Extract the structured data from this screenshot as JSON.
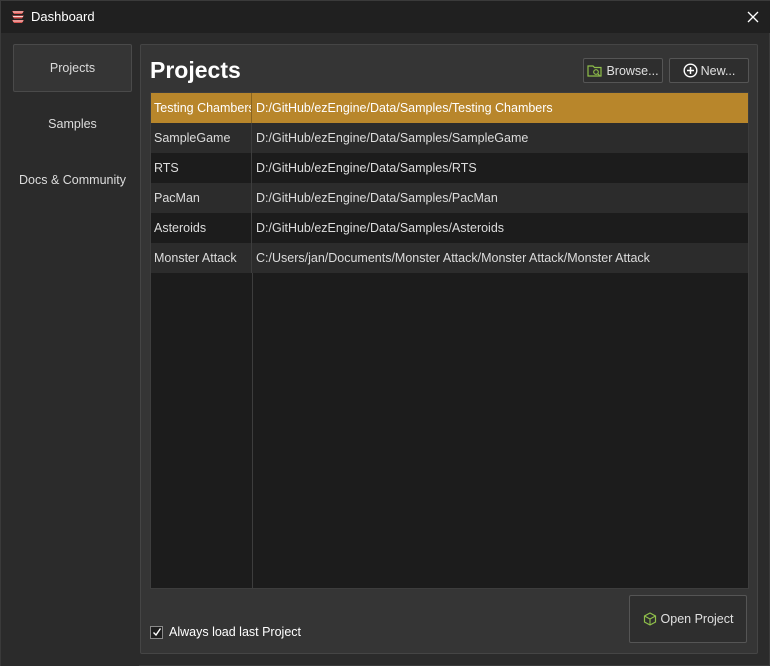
{
  "window": {
    "title": "Dashboard",
    "app_icon": "ez-engine-logo-icon",
    "close_icon": "close-icon"
  },
  "sidebar": {
    "items": [
      {
        "label": "Projects",
        "active": true
      },
      {
        "label": "Samples",
        "active": false
      },
      {
        "label": "Docs & Community",
        "active": false
      }
    ]
  },
  "main": {
    "title": "Projects",
    "browse_label": "Browse...",
    "browse_icon": "folder-search-icon",
    "new_label": "New...",
    "new_icon": "plus-circle-icon",
    "projects": [
      {
        "name": "Testing Chambers",
        "path": "D:/GitHub/ezEngine/Data/Samples/Testing Chambers",
        "selected": true
      },
      {
        "name": "SampleGame",
        "path": "D:/GitHub/ezEngine/Data/Samples/SampleGame",
        "selected": false
      },
      {
        "name": "RTS",
        "path": "D:/GitHub/ezEngine/Data/Samples/RTS",
        "selected": false
      },
      {
        "name": "PacMan",
        "path": "D:/GitHub/ezEngine/Data/Samples/PacMan",
        "selected": false
      },
      {
        "name": "Asteroids",
        "path": "D:/GitHub/ezEngine/Data/Samples/Asteroids",
        "selected": false
      },
      {
        "name": "Monster Attack",
        "path": "C:/Users/jan/Documents/Monster Attack/Monster Attack/Monster Attack",
        "selected": false
      }
    ],
    "always_load_label": "Always load last Project",
    "always_load_checked": true,
    "open_project_label": "Open Project",
    "open_project_icon": "cube-icon"
  },
  "colors": {
    "accent_selection": "#b8862b",
    "background": "#2b2b2b",
    "panel": "#353535",
    "list_bg": "#1c1c1c",
    "icon_green": "#8fbf4a"
  }
}
